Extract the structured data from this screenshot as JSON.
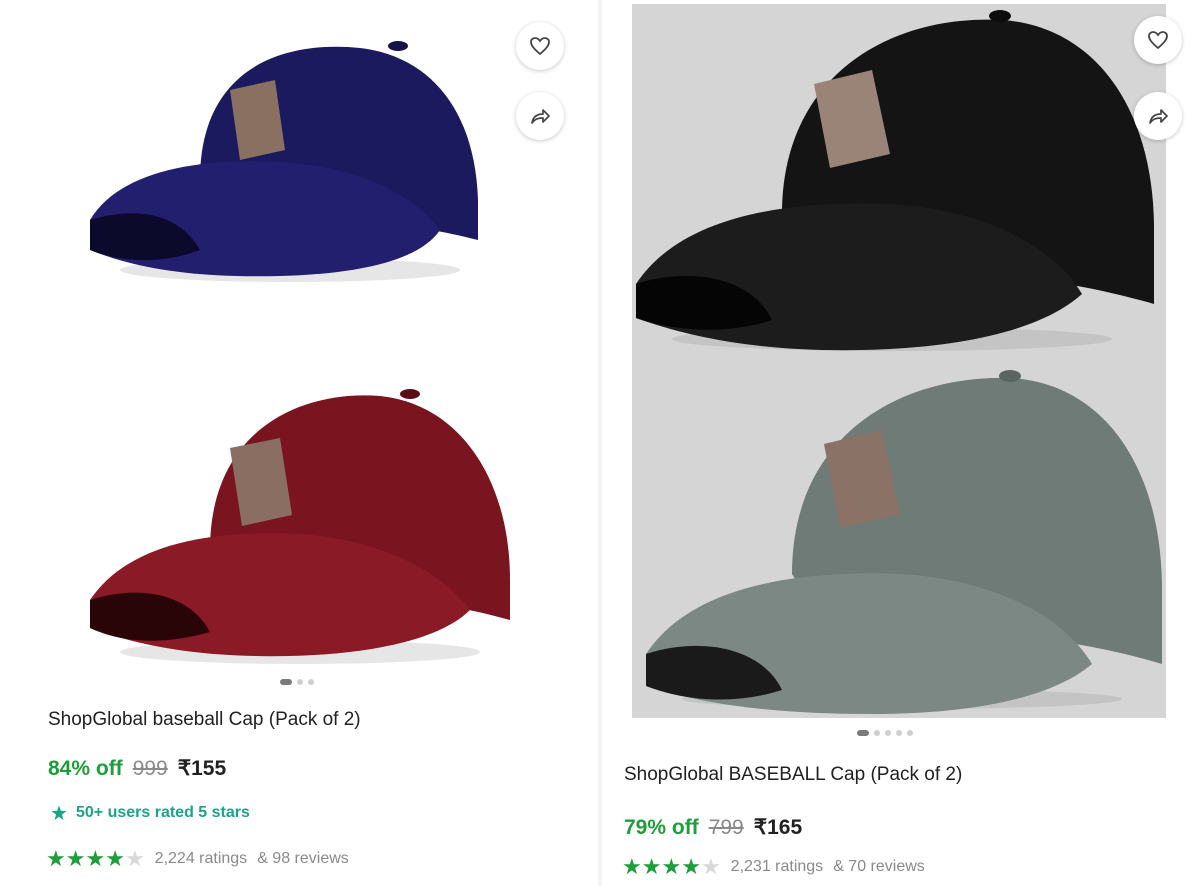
{
  "products": [
    {
      "title": "ShopGlobal baseball Cap (Pack of 2)",
      "discount": "84% off",
      "mrp": "999",
      "price": "₹155",
      "highlight": "50+ users rated 5 stars",
      "ratings_text": "2,224 ratings",
      "reviews_text": "& 98 reviews",
      "star_rating": 4,
      "carousel_dots": 3,
      "active_dot": 1,
      "cap_colors": [
        "#1c1a5e",
        "#7a1520"
      ]
    },
    {
      "title": "ShopGlobal BASEBALL Cap (Pack of 2)",
      "discount": "79% off",
      "mrp": "799",
      "price": "₹165",
      "ratings_text": "2,231 ratings",
      "reviews_text": "& 70 reviews",
      "star_rating": 4,
      "carousel_dots": 5,
      "active_dot": 1,
      "cap_colors": [
        "#121212",
        "#6e7b77"
      ]
    }
  ],
  "icons": {
    "wishlist": "heart-outline-icon",
    "share": "share-arrow-icon",
    "highlight": "sparkle-star-icon",
    "rating": "star-icon"
  },
  "colors": {
    "discount_green": "#1f9d3a",
    "highlight_teal": "#1aa58a",
    "star_green": "#1f9d3a",
    "muted_gray": "#8a8a8a"
  }
}
